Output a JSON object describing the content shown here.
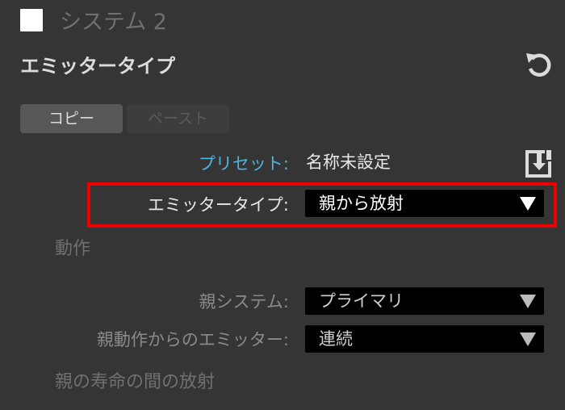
{
  "header": {
    "system_title": "システム 2",
    "checkbox_checked": false
  },
  "section": {
    "title": "エミッタータイプ",
    "reset_icon": "reset-icon"
  },
  "buttons": {
    "copy_label": "コピー",
    "paste_label": "ペースト"
  },
  "preset": {
    "label": "プリセット:",
    "value": "名称未設定",
    "save_icon": "save-preset-icon"
  },
  "emitter_type": {
    "label": "エミッタータイプ:",
    "value": "親から放射"
  },
  "motion": {
    "heading": "動作",
    "parent_system_label": "親システム:",
    "parent_system_value": "プライマリ",
    "parent_emitter_label": "親動作からのエミッター:",
    "parent_emitter_value": "連続"
  },
  "lifetime": {
    "heading": "親の寿命の間の放射"
  },
  "colors": {
    "background": "#353535",
    "accent_link": "#4fb4de",
    "highlight": "#ee0000",
    "dropdown_bg": "#000000"
  }
}
